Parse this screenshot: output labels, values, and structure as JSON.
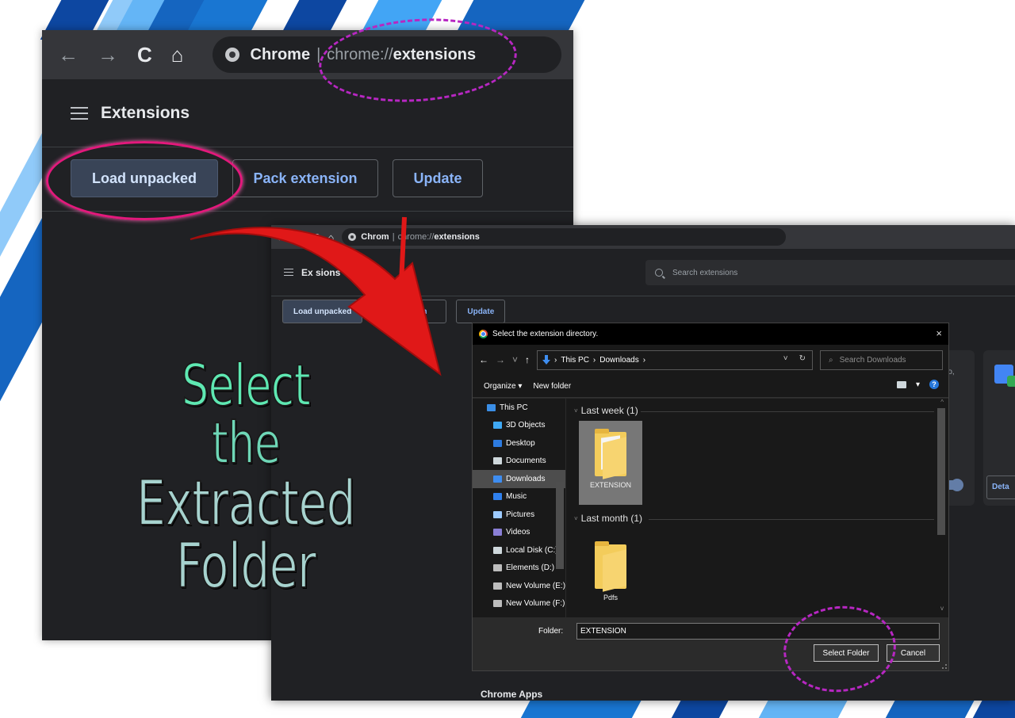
{
  "back_window": {
    "toolbar": {
      "nav": [
        "←",
        "→",
        "C",
        "⌂"
      ],
      "site": "Chrome",
      "url_dim": "chrome://",
      "url_strong": "extensions"
    },
    "header_title": "Extensions",
    "buttons": {
      "load_unpacked": "Load unpacked",
      "pack_extension": "Pack extension",
      "update": "Update"
    }
  },
  "caption": {
    "line1": "Select",
    "line2": "the",
    "line3": "Extracted Folder"
  },
  "front_window": {
    "toolbar": {
      "nav": [
        "←",
        "→",
        "C",
        "⌂"
      ],
      "site": "Chrom",
      "url_dim": "chrome://",
      "url_strong": "extensions"
    },
    "header_title": "Ex    sions",
    "search_placeholder": "Search extensions",
    "buttons": {
      "load_unpacked": "Load unpacked",
      "pack_extension": "k exte   ion",
      "update": "Update"
    },
    "partial_card_text": "nto,",
    "details_button": "Deta",
    "chrome_apps": "Chrome Apps"
  },
  "dialog": {
    "title": "Select the extension directory.",
    "close": "×",
    "nav": {
      "back": "←",
      "forward": "→",
      "recent": "˅",
      "up": "↑"
    },
    "path": [
      "This PC",
      "Downloads"
    ],
    "path_sep": "›",
    "path_tools": [
      "˅",
      "↻"
    ],
    "search_placeholder": "Search Downloads",
    "search_icon": "⌕",
    "commands": {
      "organize": "Organize ▾",
      "new_folder": "New folder"
    },
    "view_dropdown": "▾",
    "help": "?",
    "tree": [
      {
        "label": "This PC",
        "icon_color": "#3a8ee6",
        "root": true
      },
      {
        "label": "3D Objects",
        "icon_color": "#3fa9f5"
      },
      {
        "label": "Desktop",
        "icon_color": "#2d7be0"
      },
      {
        "label": "Documents",
        "icon_color": "#cfd8dc"
      },
      {
        "label": "Downloads",
        "icon_color": "#3e8df0",
        "selected": true
      },
      {
        "label": "Music",
        "icon_color": "#2f80ed"
      },
      {
        "label": "Pictures",
        "icon_color": "#9ecbff"
      },
      {
        "label": "Videos",
        "icon_color": "#8a7fd6"
      },
      {
        "label": "Local Disk (C:)",
        "icon_color": "#cfd8dc"
      },
      {
        "label": "Elements (D:)",
        "icon_color": "#bdbdbd"
      },
      {
        "label": "New Volume (E:)",
        "icon_color": "#bdbdbd"
      },
      {
        "label": "New Volume (F:)",
        "icon_color": "#bdbdbd"
      }
    ],
    "groups": [
      {
        "heading": "Last week (1)",
        "files": [
          {
            "name": "EXTENSION",
            "selected": true
          }
        ]
      },
      {
        "heading": "Last month (1)",
        "files": [
          {
            "name": "Pdfs",
            "selected": false
          }
        ]
      }
    ],
    "group_chevron": "˅",
    "folder_label": "Folder:",
    "folder_value": "EXTENSION",
    "select_folder": "Select Folder",
    "cancel": "Cancel"
  },
  "colors": {
    "chrome_dark": "#202124",
    "chrome_toolbar": "#35363a",
    "chrome_blue": "#8ab4f8",
    "annotation_pink": "#e3197c",
    "annotation_purple": "#b727c2",
    "arrow_red": "#e01818",
    "caption_green": "#5ee8b2",
    "stripe_blue": "#1565c0"
  }
}
